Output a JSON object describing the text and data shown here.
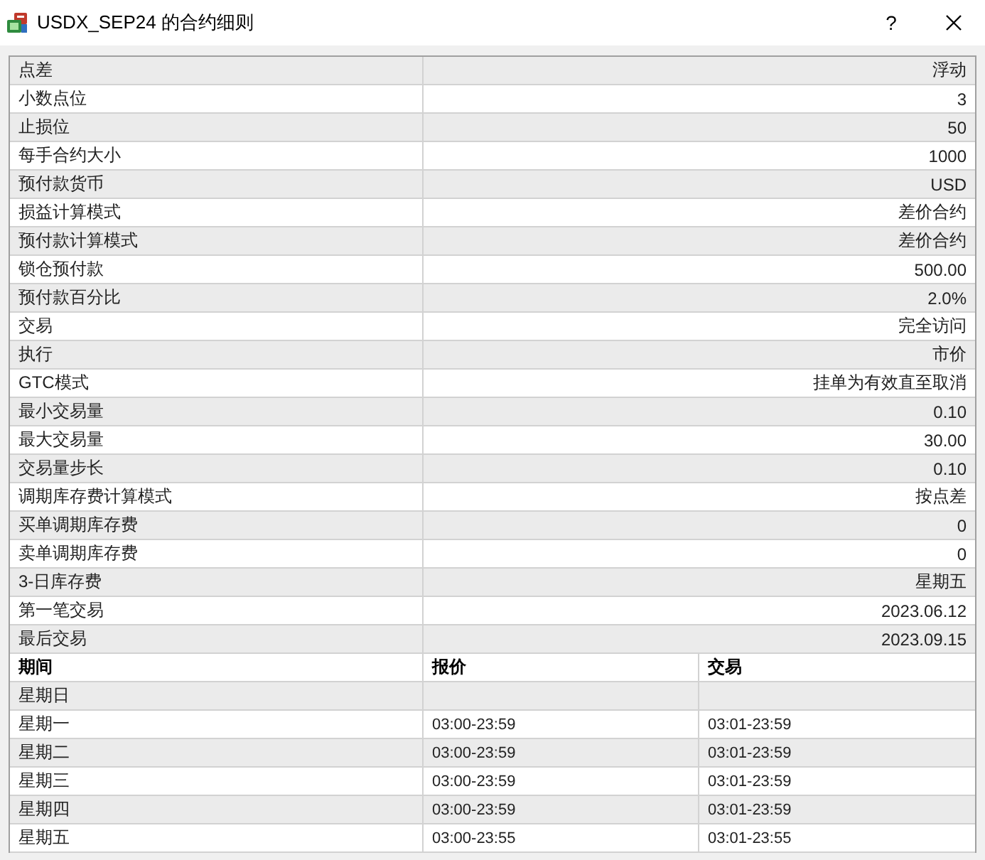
{
  "window": {
    "title": "USDX_SEP24 的合约细则",
    "help_button": "?"
  },
  "properties": [
    {
      "name": "点差",
      "value": "浮动"
    },
    {
      "name": "小数点位",
      "value": "3"
    },
    {
      "name": "止损位",
      "value": "50"
    },
    {
      "name": "每手合约大小",
      "value": "1000"
    },
    {
      "name": "预付款货币",
      "value": "USD"
    },
    {
      "name": "损益计算模式",
      "value": "差价合约"
    },
    {
      "name": "预付款计算模式",
      "value": "差价合约"
    },
    {
      "name": "锁仓预付款",
      "value": "500.00"
    },
    {
      "name": "预付款百分比",
      "value": "2.0%"
    },
    {
      "name": "交易",
      "value": "完全访问"
    },
    {
      "name": "执行",
      "value": "市价"
    },
    {
      "name": "GTC模式",
      "value": "挂单为有效直至取消"
    },
    {
      "name": "最小交易量",
      "value": "0.10"
    },
    {
      "name": "最大交易量",
      "value": "30.00"
    },
    {
      "name": "交易量步长",
      "value": "0.10"
    },
    {
      "name": "调期库存费计算模式",
      "value": "按点差"
    },
    {
      "name": "买单调期库存费",
      "value": "0"
    },
    {
      "name": "卖单调期库存费",
      "value": "0"
    },
    {
      "name": "3-日库存费",
      "value": "星期五"
    },
    {
      "name": "第一笔交易",
      "value": "2023.06.12"
    },
    {
      "name": "最后交易",
      "value": "2023.09.15"
    }
  ],
  "sessions": {
    "columns": [
      "期间",
      "报价",
      "交易"
    ],
    "rows": [
      {
        "day": "星期日"
      },
      {
        "day": "星期一",
        "quotes": "03:00-23:59",
        "trade": "03:01-23:59"
      },
      {
        "day": "星期二",
        "quotes": "03:00-23:59",
        "trade": "03:01-23:59"
      },
      {
        "day": "星期三",
        "quotes": "03:00-23:59",
        "trade": "03:01-23:59"
      },
      {
        "day": "星期四",
        "quotes": "03:00-23:59",
        "trade": "03:01-23:59"
      },
      {
        "day": "星期五",
        "quotes": "03:00-23:55",
        "trade": "03:01-23:55"
      }
    ]
  }
}
